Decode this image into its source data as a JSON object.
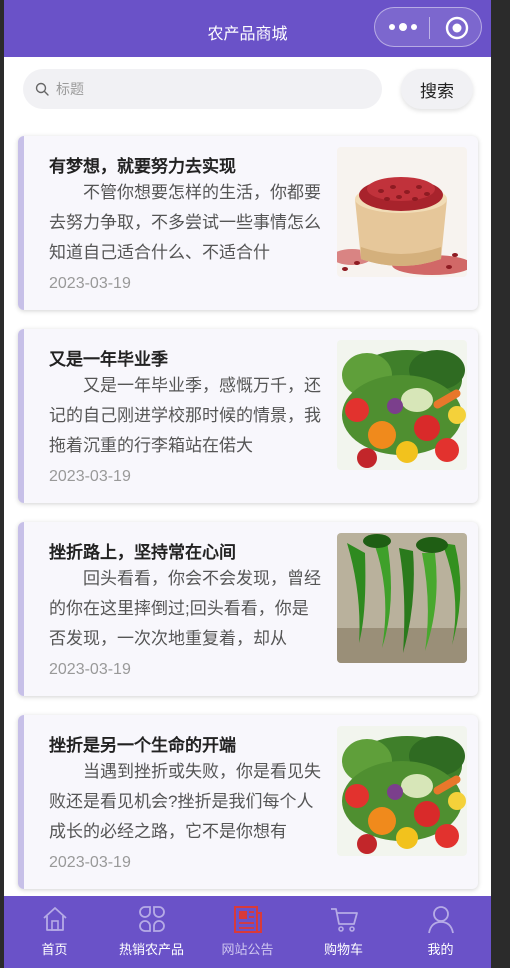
{
  "header": {
    "title": "农产品商城"
  },
  "search": {
    "placeholder": "标题",
    "button_label": "搜索"
  },
  "articles": [
    {
      "title": "有梦想，就要努力去实现",
      "summary": "不管你想要怎样的生活，你都要去努力争取，不多尝试一些事情怎么知道自己适合什么、不适合什",
      "date": "2023-03-19",
      "image": "red-beans-photo"
    },
    {
      "title": "又是一年毕业季",
      "summary": "又是一年毕业季，感慨万千，还记的自己刚进学校那时候的情景，我拖着沉重的行李箱站在偌大",
      "date": "2023-03-19",
      "image": "vegetables-photo"
    },
    {
      "title": "挫折路上，坚持常在心间",
      "summary": "回头看看，你会不会发现，曾经的你在这里摔倒过;回头看看，你是否发现，一次次地重复着，却从",
      "date": "2023-03-19",
      "image": "green-peppers-photo"
    },
    {
      "title": "挫折是另一个生命的开端",
      "summary": "当遇到挫折或失败，你是看见失败还是看见机会?挫折是我们每个人成长的必经之路，它不是你想有",
      "date": "2023-03-19",
      "image": "vegetables-photo"
    }
  ],
  "tabbar": {
    "items": [
      {
        "label": "首页",
        "icon": "home-icon"
      },
      {
        "label": "热销农产品",
        "icon": "grid-icon"
      },
      {
        "label": "网站公告",
        "icon": "news-icon",
        "active": true
      },
      {
        "label": "购物车",
        "icon": "cart-icon"
      },
      {
        "label": "我的",
        "icon": "user-icon"
      }
    ]
  },
  "colors": {
    "brand": "#6a52c8",
    "active_icon": "#d93a3a",
    "card_accent": "#c7c0e8"
  }
}
